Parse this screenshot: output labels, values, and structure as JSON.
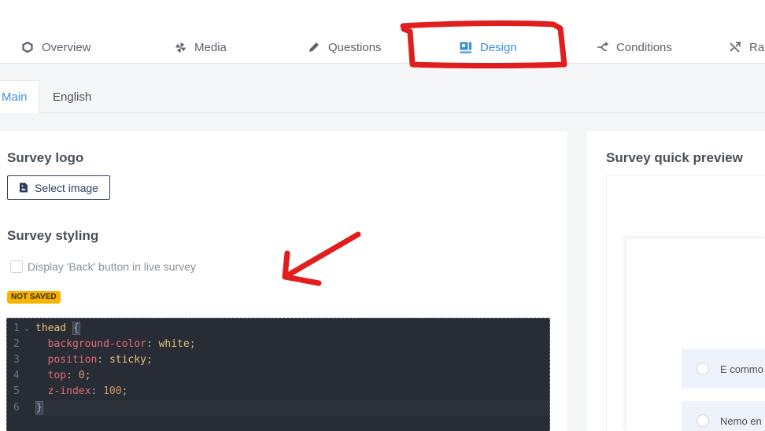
{
  "tabs": [
    {
      "label": "Overview",
      "icon": "hexagon-icon"
    },
    {
      "label": "Media",
      "icon": "pinwheel-icon"
    },
    {
      "label": "Questions",
      "icon": "pencil-icon"
    },
    {
      "label": "Design",
      "icon": "layout-icon",
      "active": true
    },
    {
      "label": "Conditions",
      "icon": "branch-icon"
    },
    {
      "label": "Ra",
      "icon": "shuffle-icon"
    }
  ],
  "language_tabs": [
    {
      "label": "Main",
      "active": true
    },
    {
      "label": "English"
    }
  ],
  "logo_section": {
    "title": "Survey logo",
    "select_image_label": "Select image"
  },
  "styling_section": {
    "title": "Survey styling",
    "back_button_label": "Display 'Back' button in live survey",
    "back_button_checked": false,
    "status_badge": "NOT SAVED"
  },
  "css_editor": {
    "lines": [
      {
        "num": "1",
        "selector": "thead",
        "open_brace": "{"
      },
      {
        "num": "2",
        "property": "background-color",
        "value": "white"
      },
      {
        "num": "3",
        "property": "position",
        "value": "sticky"
      },
      {
        "num": "4",
        "property": "top",
        "value": "0"
      },
      {
        "num": "5",
        "property": "z-index",
        "value": "100"
      },
      {
        "num": "6",
        "close_brace": "}"
      }
    ]
  },
  "preview": {
    "title": "Survey quick preview",
    "options": [
      "E commo",
      "Nemo en"
    ]
  },
  "colors": {
    "accent": "#3a8fe0",
    "badge": "#f7b500",
    "annotation": "#e11d1d",
    "editor_bg": "#282c34"
  }
}
